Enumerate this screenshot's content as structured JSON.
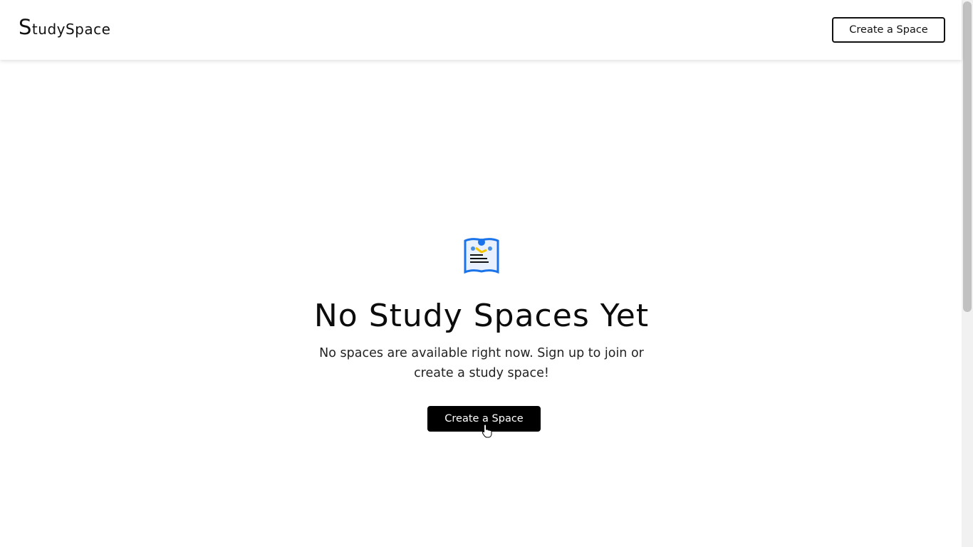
{
  "header": {
    "logo_first_letter": "S",
    "logo_rest_1": "tudy",
    "logo_rest_2": "Space",
    "create_button": "Create a Space"
  },
  "empty_state": {
    "icon": "study-book-icon",
    "title": "No Study Spaces Yet",
    "message": "No spaces are available right now. Sign up to join or create a study space!",
    "create_button": "Create a Space"
  },
  "colors": {
    "primary": "#000000",
    "icon_blue": "#1a73e8",
    "icon_yellow": "#f7c600"
  }
}
